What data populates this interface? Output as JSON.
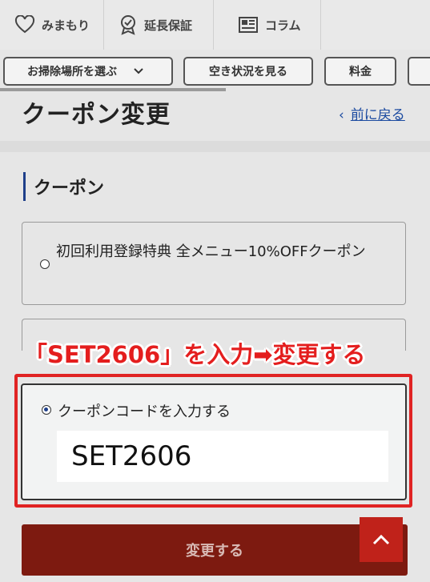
{
  "topnav": {
    "tabs": [
      {
        "label": "みまもり",
        "icon": "heart-icon"
      },
      {
        "label": "延長保証",
        "icon": "badge-check-icon"
      },
      {
        "label": "コラム",
        "icon": "newspaper-icon"
      }
    ]
  },
  "subnav": {
    "select_area": "お掃除場所を選ぶ",
    "availability": "空き状況を見る",
    "price": "料金"
  },
  "page": {
    "title": "クーポン変更",
    "back_arrow": "‹",
    "back_label": "前に戻る"
  },
  "section": {
    "title": "クーポン"
  },
  "coupons": {
    "option1": "初回利用登録特典 全メニュー10%OFFクーポン",
    "option_code_label": "クーポンコードを入力する",
    "code_value": "SET2606"
  },
  "annotation": {
    "text": "「SET2606」を入力➡変更する"
  },
  "actions": {
    "submit": "変更する"
  },
  "colors": {
    "accent": "#1e3f8a",
    "submit": "#7d1a10",
    "highlight": "#e02323"
  }
}
